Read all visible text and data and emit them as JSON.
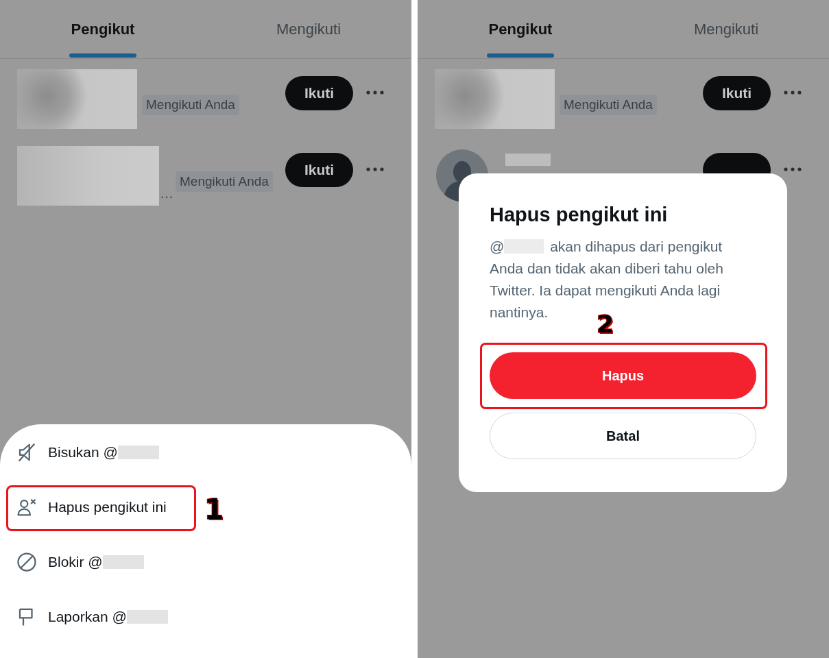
{
  "screens": [
    {
      "tabs": [
        {
          "label": "Pengikut",
          "selected": true
        },
        {
          "label": "Mengikuti",
          "selected": false
        }
      ],
      "followers": [
        {
          "kind": "blurred",
          "badge": "Mengikuti Anda",
          "button": "Ikuti"
        },
        {
          "kind": "blurred",
          "truncation": "…",
          "badge": "Mengikuti Anda",
          "button": "Ikuti"
        }
      ],
      "menu": {
        "items": [
          {
            "kind": "mute",
            "label": "Bisukan @",
            "highlighted": false
          },
          {
            "kind": "remove",
            "label": "Hapus pengikut ini",
            "highlighted": true
          },
          {
            "kind": "block",
            "label": "Blokir @",
            "highlighted": false
          },
          {
            "kind": "report",
            "label": "Laporkan @",
            "highlighted": false
          }
        ]
      },
      "step": "1"
    },
    {
      "tabs": [
        {
          "label": "Pengikut",
          "selected": true
        },
        {
          "label": "Mengikuti",
          "selected": false
        }
      ],
      "followers": [
        {
          "kind": "blurred",
          "badge": "Mengikuti Anda",
          "button": "Ikuti"
        },
        {
          "kind": "avatar"
        }
      ],
      "dialog": {
        "title": "Hapus pengikut ini",
        "body_prefix": "@",
        "body": "akan dihapus dari pengikut Anda dan tidak akan diberi tahu oleh Twitter. Ia dapat mengikuti Anda lagi nantinya.",
        "buttons": [
          {
            "kind": "danger",
            "label": "Hapus",
            "highlighted": true
          },
          {
            "kind": "outline",
            "label": "Batal",
            "highlighted": false
          }
        ]
      },
      "step": "2"
    }
  ]
}
